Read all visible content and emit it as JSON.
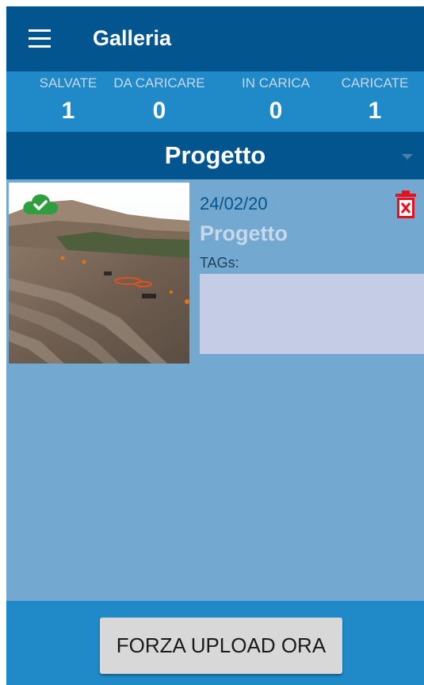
{
  "appbar": {
    "title": "Galleria",
    "menu_icon": "hamburger-menu-icon"
  },
  "stats": [
    {
      "label": "SALVATE",
      "value": "1"
    },
    {
      "label": "DA CARICARE",
      "value": "0"
    },
    {
      "label": "IN CARICA",
      "value": "0"
    },
    {
      "label": "CARICATE",
      "value": "1"
    }
  ],
  "project_selector": {
    "selected": "Progetto",
    "arrow_icon": "dropdown-arrow-icon"
  },
  "gallery": {
    "items": [
      {
        "date": "24/02/20",
        "title": "Progetto",
        "tags_label": "TAGs:",
        "tags_value": "",
        "status_icon": "cloud-uploaded-check-icon",
        "delete_icon": "trash-delete-icon",
        "thumbnail": "construction-site-photo"
      }
    ]
  },
  "footer": {
    "upload_button": "FORZA UPLOAD ORA"
  },
  "colors": {
    "appbar": "#02558f",
    "stats_bar": "#1f8ac7",
    "background": "#73a9d1",
    "tags_box": "#c5cde6",
    "delete_red": "#e8101a",
    "cloud_green": "#2e9e3e"
  }
}
